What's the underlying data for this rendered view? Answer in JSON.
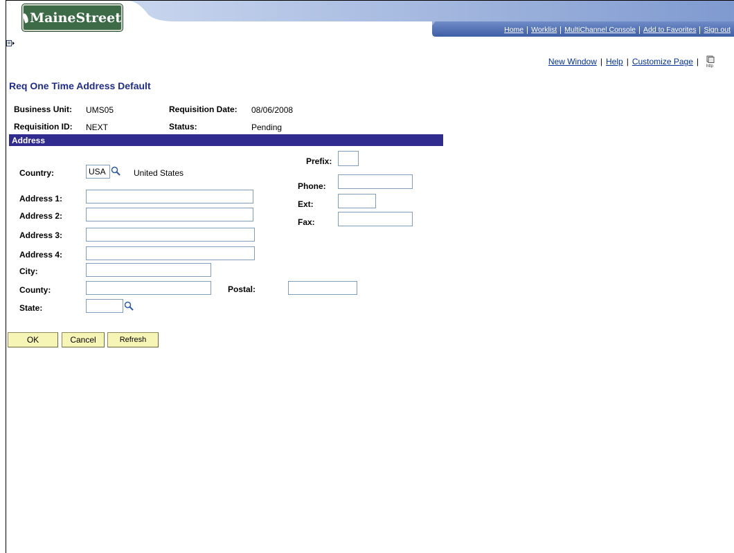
{
  "header": {
    "logo_text": "MaineStreet",
    "nav": [
      {
        "label": "Home"
      },
      {
        "label": "Worklist"
      },
      {
        "label": "MultiChannel Console"
      },
      {
        "label": "Add to Favorites"
      },
      {
        "label": "Sign out"
      }
    ]
  },
  "toplinks": {
    "new_window": "New Window",
    "help": "Help",
    "customize_page": "Customize Page",
    "http_icon_text": "http"
  },
  "page": {
    "title": "Req One Time Address Default"
  },
  "info": {
    "business_unit_label": "Business Unit:",
    "business_unit_value": "UMS05",
    "requisition_date_label": "Requisition Date:",
    "requisition_date_value": "08/06/2008",
    "requisition_id_label": "Requisition ID:",
    "requisition_id_value": "NEXT",
    "status_label": "Status:",
    "status_value": "Pending"
  },
  "address": {
    "section_title": "Address",
    "country_label": "Country:",
    "country_value": "USA",
    "country_description": "United States",
    "address1_label": "Address 1:",
    "address2_label": "Address 2:",
    "address3_label": "Address 3:",
    "address4_label": "Address 4:",
    "city_label": "City:",
    "county_label": "County:",
    "state_label": "State:",
    "postal_label": "Postal:",
    "prefix_label": "Prefix:",
    "phone_label": "Phone:",
    "ext_label": "Ext:",
    "fax_label": "Fax:",
    "address1_value": "",
    "address2_value": "",
    "address3_value": "",
    "address4_value": "",
    "city_value": "",
    "county_value": "",
    "state_value": "",
    "postal_value": "",
    "prefix_value": "",
    "phone_value": "",
    "ext_value": "",
    "fax_value": ""
  },
  "buttons": {
    "ok": "OK",
    "cancel": "Cancel",
    "refresh": "Refresh"
  },
  "colors": {
    "banner_blue": "#4f6fb0",
    "title_color": "#1e2c8e",
    "section_bar": "#2f2b8f",
    "link_color": "#00309c",
    "button_bg": "#f7f5b5",
    "logo_green": "#3d6b47"
  },
  "icons": {
    "menu": "page-menu-icon",
    "lookup": "magnifier-icon",
    "http": "http-icon"
  }
}
